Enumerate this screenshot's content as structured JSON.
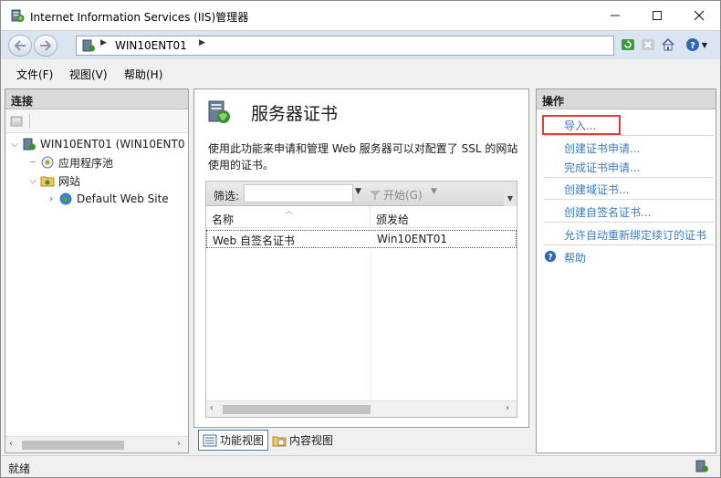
{
  "window": {
    "title": "Internet Information Services (IIS)管理器"
  },
  "address": {
    "crumb": "WIN10ENT01"
  },
  "menu": {
    "items": [
      "文件(F)",
      "视图(V)",
      "帮助(H)"
    ]
  },
  "left_pane": {
    "header": "连接",
    "tree": [
      {
        "label": "WIN10ENT01 (WIN10ENT0",
        "icon": "server-icon",
        "expanded": true
      },
      {
        "label": "应用程序池",
        "icon": "app-pool-icon"
      },
      {
        "label": "网站",
        "icon": "folder-icon",
        "expanded": true
      },
      {
        "label": "Default Web Site",
        "icon": "globe-icon",
        "expanded": false
      }
    ]
  },
  "center_pane": {
    "title": "服务器证书",
    "description": "使用此功能来申请和管理 Web 服务器可以对配置了 SSL 的网站使用的证书。",
    "filter": {
      "label": "筛选:",
      "value": "",
      "start_label": "开始(G)"
    },
    "list": {
      "columns": [
        "名称",
        "颁发给"
      ],
      "rows": [
        {
          "name": "Web 自签名证书",
          "issued_to": "Win10ENT01"
        }
      ]
    }
  },
  "view_tabs": {
    "feature_view": "功能视图",
    "content_view": "内容视图"
  },
  "right_pane": {
    "header": "操作",
    "actions": [
      "导入...",
      "创建证书申请...",
      "完成证书申请...",
      "创建域证书...",
      "创建自签名证书...",
      "允许自动重新绑定续订的证书",
      "帮助"
    ],
    "highlighted_action": "导入..."
  },
  "status": {
    "text": "就绪"
  },
  "colors": {
    "link": "#3a7cc6",
    "highlight_border": "#e03c3c",
    "address_bar_bg": "#dbe5f1"
  }
}
